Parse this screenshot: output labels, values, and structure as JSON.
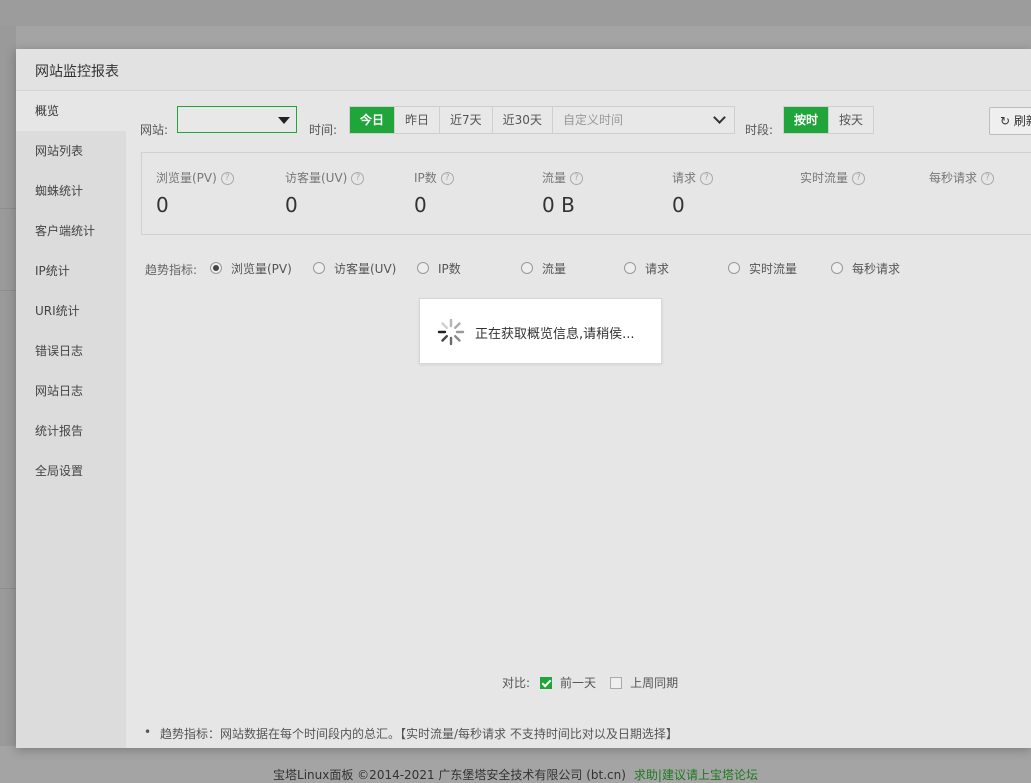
{
  "footer": {
    "copyright": "宝塔Linux面板 ©2014-2021 广东堡塔安全技术有限公司 (bt.cn)",
    "forum_link": "求助|建议请上宝塔论坛"
  },
  "dialog": {
    "title": "网站监控报表"
  },
  "sidebar": {
    "items": [
      {
        "label": "概览",
        "active": true
      },
      {
        "label": "网站列表"
      },
      {
        "label": "蜘蛛统计"
      },
      {
        "label": "客户端统计"
      },
      {
        "label": "IP统计"
      },
      {
        "label": "URI统计"
      },
      {
        "label": "错误日志"
      },
      {
        "label": "网站日志"
      },
      {
        "label": "统计报告"
      },
      {
        "label": "全局设置"
      }
    ]
  },
  "toolbar": {
    "site_label": "网站:",
    "site_value": "",
    "time_label": "时间:",
    "time_buttons": [
      {
        "label": "今日",
        "active": true
      },
      {
        "label": "昨日"
      },
      {
        "label": "近7天"
      },
      {
        "label": "近30天"
      }
    ],
    "custom_time_placeholder": "自定义时间",
    "period_label": "时段:",
    "period_buttons": [
      {
        "label": "按时",
        "active": true
      },
      {
        "label": "按天"
      }
    ],
    "refresh_label": "刷新"
  },
  "stats": [
    {
      "name": "浏览量(PV)",
      "value": "0"
    },
    {
      "name": "访客量(UV)",
      "value": "0"
    },
    {
      "name": "IP数",
      "value": "0"
    },
    {
      "name": "流量",
      "value": "0 B"
    },
    {
      "name": "请求",
      "value": "0"
    },
    {
      "name": "实时流量",
      "value": ""
    },
    {
      "name": "每秒请求",
      "value": ""
    }
  ],
  "trend": {
    "label": "趋势指标:",
    "options": [
      {
        "label": "浏览量(PV)",
        "selected": true
      },
      {
        "label": "访客量(UV)"
      },
      {
        "label": "IP数"
      },
      {
        "label": "流量"
      },
      {
        "label": "请求"
      },
      {
        "label": "实时流量"
      },
      {
        "label": "每秒请求"
      }
    ]
  },
  "loading": {
    "message": "正在获取概览信息,请稍侯..."
  },
  "compare": {
    "label": "对比:",
    "options": [
      {
        "label": "前一天",
        "checked": true
      },
      {
        "label": "上周同期",
        "checked": false
      }
    ]
  },
  "note": "趋势指标：网站数据在每个时间段内的总汇。【实时流量/每秒请求 不支持时间比对以及日期选择】",
  "colors": {
    "accent": "#20a53a",
    "link": "#1f7a1f"
  }
}
